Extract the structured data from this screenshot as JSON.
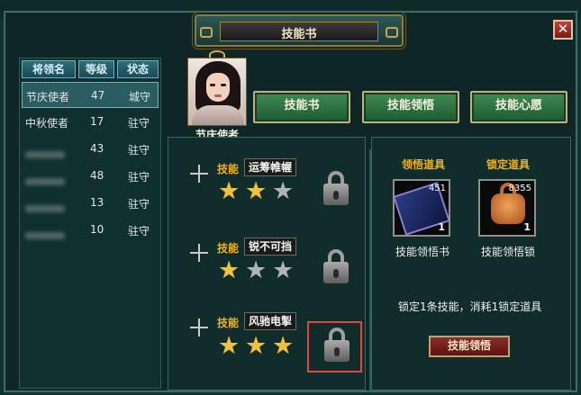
{
  "window": {
    "title": "技能书",
    "close_label": "✕"
  },
  "list": {
    "headers": [
      "将领名",
      "等级",
      "状态"
    ],
    "rows": [
      {
        "name": "节庆使者",
        "level": "47",
        "status": "城守",
        "selected": true
      },
      {
        "name": "中秋使者",
        "level": "17",
        "status": "驻守",
        "selected": false
      },
      {
        "name": "",
        "level": "43",
        "status": "驻守",
        "selected": false
      },
      {
        "name": "",
        "level": "48",
        "status": "驻守",
        "selected": false
      },
      {
        "name": "",
        "level": "13",
        "status": "驻守",
        "selected": false
      },
      {
        "name": "",
        "level": "10",
        "status": "驻守",
        "selected": false
      }
    ]
  },
  "general": {
    "name": "节庆使者"
  },
  "tabs": [
    "技能书",
    "技能领悟",
    "技能心愿"
  ],
  "skills": [
    {
      "tag": "技能",
      "name": "运筹帷幄",
      "stars": [
        true,
        true,
        false
      ],
      "locked": true
    },
    {
      "tag": "技能",
      "name": "锐不可挡",
      "stars": [
        true,
        false,
        false
      ],
      "locked": true
    },
    {
      "tag": "技能",
      "name": "风驰电掣",
      "stars": [
        true,
        true,
        true
      ],
      "locked": true
    }
  ],
  "items": {
    "comprehend_header": "领悟道具",
    "lock_header": "锁定道具",
    "comprehend": {
      "label": "技能领悟书",
      "count": "451",
      "num": "1"
    },
    "lock": {
      "label": "技能领悟锁",
      "count": "8355",
      "num": "1"
    }
  },
  "note": "锁定1条技能，消耗1锁定道具",
  "action_button": "技能领悟",
  "colors": {
    "accent_gold": "#f2b21c",
    "highlight_red": "#e0463c"
  }
}
